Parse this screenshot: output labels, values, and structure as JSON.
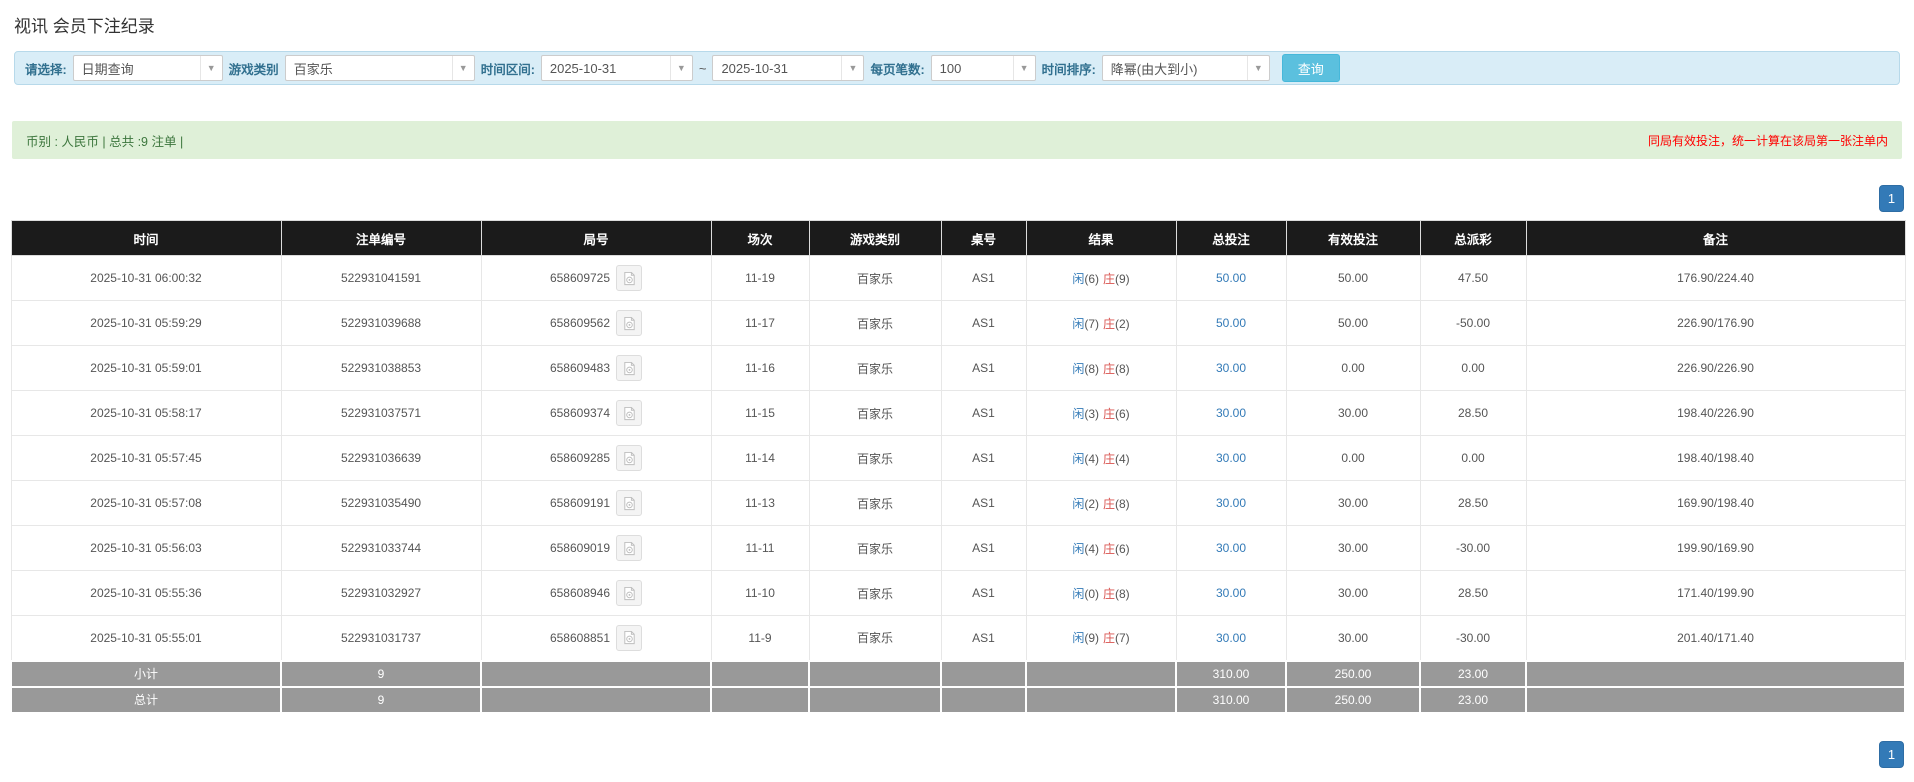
{
  "page": {
    "title": "视讯 会员下注纪录"
  },
  "filters": {
    "mode_label": "请选择:",
    "mode_value": "日期查询",
    "game_type_label": "游戏类别",
    "game_type_value": "百家乐",
    "date_range_label": "时间区间:",
    "date_from": "2025-10-31",
    "date_separator": "~",
    "date_to": "2025-10-31",
    "page_size_label": "每页笔数:",
    "page_size_value": "100",
    "sort_label": "时间排序:",
    "sort_value": "降幂(由大到小)",
    "search_button": "查询",
    "dropdown_arrow": "▼"
  },
  "summary": {
    "left_text": "币别 : 人民币 | 总共 :9 注单 |",
    "right_text": "同局有效投注，统一计算在该局第一张注单内"
  },
  "pagination": {
    "page": "1"
  },
  "table": {
    "headers": [
      "时间",
      "注单编号",
      "局号",
      "场次",
      "游戏类别",
      "桌号",
      "结果",
      "总投注",
      "有效投注",
      "总派彩",
      "备注"
    ],
    "rows": [
      {
        "time": "2025-10-31 06:00:32",
        "bet_id": "522931041591",
        "round_id": "658609725",
        "session": "11-19",
        "game_type": "百家乐",
        "table_no": "AS1",
        "player": "闲",
        "player_score": "(6)",
        "banker": "庄",
        "banker_score": "(9)",
        "total_bet": "50.00",
        "valid_bet": "50.00",
        "payout": "47.50",
        "payout_negative": false,
        "remark": "176.90/224.40"
      },
      {
        "time": "2025-10-31 05:59:29",
        "bet_id": "522931039688",
        "round_id": "658609562",
        "session": "11-17",
        "game_type": "百家乐",
        "table_no": "AS1",
        "player": "闲",
        "player_score": "(7)",
        "banker": "庄",
        "banker_score": "(2)",
        "total_bet": "50.00",
        "valid_bet": "50.00",
        "payout": "-50.00",
        "payout_negative": true,
        "remark": "226.90/176.90"
      },
      {
        "time": "2025-10-31 05:59:01",
        "bet_id": "522931038853",
        "round_id": "658609483",
        "session": "11-16",
        "game_type": "百家乐",
        "table_no": "AS1",
        "player": "闲",
        "player_score": "(8)",
        "banker": "庄",
        "banker_score": "(8)",
        "total_bet": "30.00",
        "valid_bet": "0.00",
        "payout": "0.00",
        "payout_negative": false,
        "remark": "226.90/226.90"
      },
      {
        "time": "2025-10-31 05:58:17",
        "bet_id": "522931037571",
        "round_id": "658609374",
        "session": "11-15",
        "game_type": "百家乐",
        "table_no": "AS1",
        "player": "闲",
        "player_score": "(3)",
        "banker": "庄",
        "banker_score": "(6)",
        "total_bet": "30.00",
        "valid_bet": "30.00",
        "payout": "28.50",
        "payout_negative": false,
        "remark": "198.40/226.90"
      },
      {
        "time": "2025-10-31 05:57:45",
        "bet_id": "522931036639",
        "round_id": "658609285",
        "session": "11-14",
        "game_type": "百家乐",
        "table_no": "AS1",
        "player": "闲",
        "player_score": "(4)",
        "banker": "庄",
        "banker_score": "(4)",
        "total_bet": "30.00",
        "valid_bet": "0.00",
        "payout": "0.00",
        "payout_negative": false,
        "remark": "198.40/198.40"
      },
      {
        "time": "2025-10-31 05:57:08",
        "bet_id": "522931035490",
        "round_id": "658609191",
        "session": "11-13",
        "game_type": "百家乐",
        "table_no": "AS1",
        "player": "闲",
        "player_score": "(2)",
        "banker": "庄",
        "banker_score": "(8)",
        "total_bet": "30.00",
        "valid_bet": "30.00",
        "payout": "28.50",
        "payout_negative": false,
        "remark": "169.90/198.40"
      },
      {
        "time": "2025-10-31 05:56:03",
        "bet_id": "522931033744",
        "round_id": "658609019",
        "session": "11-11",
        "game_type": "百家乐",
        "table_no": "AS1",
        "player": "闲",
        "player_score": "(4)",
        "banker": "庄",
        "banker_score": "(6)",
        "total_bet": "30.00",
        "valid_bet": "30.00",
        "payout": "-30.00",
        "payout_negative": true,
        "remark": "199.90/169.90"
      },
      {
        "time": "2025-10-31 05:55:36",
        "bet_id": "522931032927",
        "round_id": "658608946",
        "session": "11-10",
        "game_type": "百家乐",
        "table_no": "AS1",
        "player": "闲",
        "player_score": "(0)",
        "banker": "庄",
        "banker_score": "(8)",
        "total_bet": "30.00",
        "valid_bet": "30.00",
        "payout": "28.50",
        "payout_negative": false,
        "remark": "171.40/199.90"
      },
      {
        "time": "2025-10-31 05:55:01",
        "bet_id": "522931031737",
        "round_id": "658608851",
        "session": "11-9",
        "game_type": "百家乐",
        "table_no": "AS1",
        "player": "闲",
        "player_score": "(9)",
        "banker": "庄",
        "banker_score": "(7)",
        "total_bet": "30.00",
        "valid_bet": "30.00",
        "payout": "-30.00",
        "payout_negative": true,
        "remark": "201.40/171.40"
      }
    ],
    "subtotal": {
      "label": "小计",
      "count": "9",
      "total_bet": "310.00",
      "valid_bet": "250.00",
      "payout": "23.00"
    },
    "total": {
      "label": "总计",
      "count": "9",
      "total_bet": "310.00",
      "valid_bet": "250.00",
      "payout": "23.00"
    }
  },
  "colors": {
    "accent_blue": "#337ab7",
    "search_button": "#5bc0de",
    "filter_bar_bg": "#d9edf7",
    "filter_bar_border": "#b7d9ea",
    "filter_label": "#31708f",
    "summary_bg": "#dff0d8",
    "summary_text": "#3c763d",
    "alert_red": "#ff0000",
    "table_header_bg": "#1b1b1b",
    "footer_row_bg": "#999999",
    "player_blue": "#337ab7",
    "banker_red": "#d9534f",
    "negative_red": "#ff0000"
  }
}
